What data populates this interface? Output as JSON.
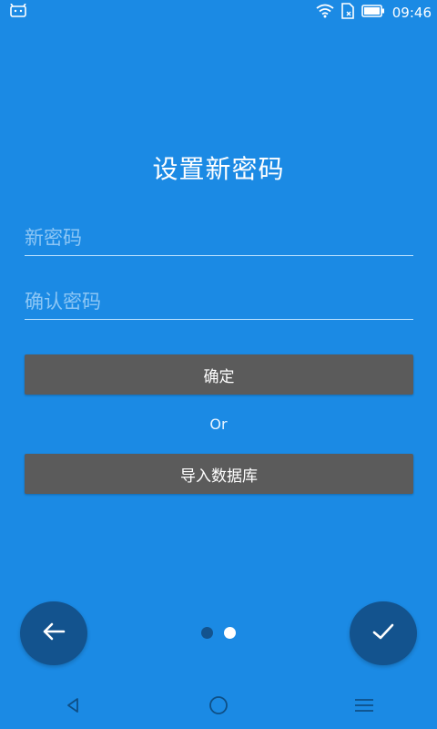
{
  "statusbar": {
    "time": "09:46"
  },
  "title": "设置新密码",
  "fields": {
    "new_password": {
      "placeholder": "新密码",
      "value": ""
    },
    "confirm_password": {
      "placeholder": "确认密码",
      "value": ""
    }
  },
  "buttons": {
    "confirm": "确定",
    "import_db": "导入数据库"
  },
  "separator": "Or",
  "pager": {
    "current_page": 2,
    "total_pages": 2
  },
  "icons": {
    "back_fab": "arrow-left-icon",
    "done_fab": "check-icon",
    "nav": [
      "back-triangle-icon",
      "home-circle-icon",
      "menu-lines-icon"
    ]
  },
  "colors": {
    "background": "#1B8AE4",
    "button": "#5B5B5B",
    "fab": "#13538E",
    "dot_inactive": "#13538E",
    "dot_active": "#FFFFFF"
  }
}
